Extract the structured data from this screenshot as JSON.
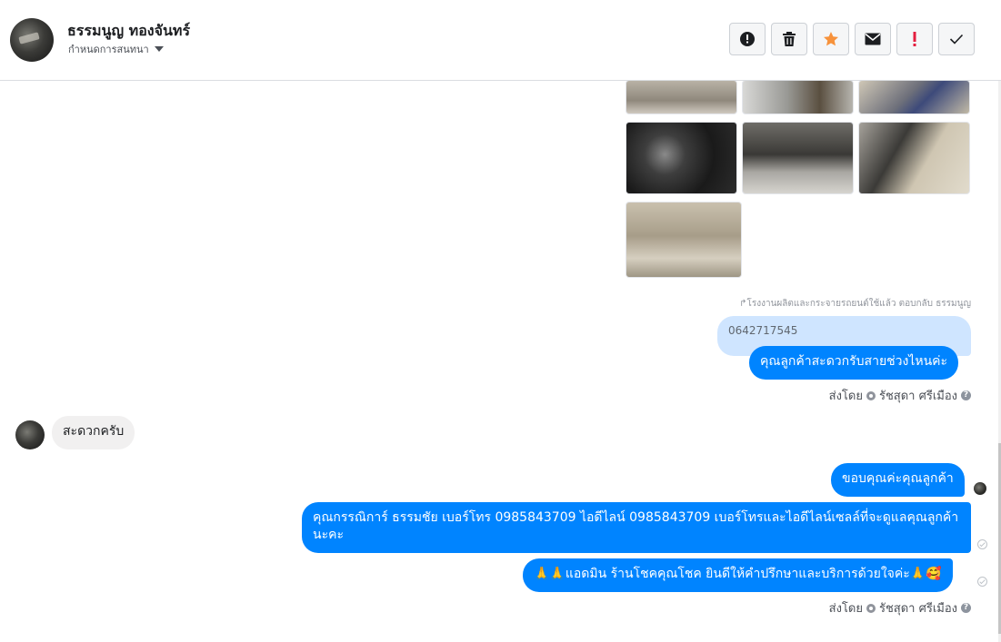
{
  "header": {
    "contact_name": "ธรรมนูญ ทองจันทร์",
    "conversation_setting": "กำหนดการสนทนา",
    "actions": [
      {
        "name": "mark-spam",
        "icon": "alert-circle-icon"
      },
      {
        "name": "delete",
        "icon": "trash-icon"
      },
      {
        "name": "star",
        "icon": "star-icon"
      },
      {
        "name": "mark-unread",
        "icon": "envelope-icon"
      },
      {
        "name": "priority",
        "icon": "exclamation-icon"
      },
      {
        "name": "done",
        "icon": "check-icon"
      }
    ]
  },
  "colors": {
    "outgoing": "#0084ff",
    "incoming": "#f1f0f0",
    "quoted": "#cfe5ff",
    "star": "#f7923b",
    "priority": "#e41e3f"
  },
  "thread": {
    "reply_note": "โรงงานผลิตและกระจายรถยนต์ใช้แล้ว ตอบกลับ ธรรมนูญ",
    "quoted_text": "0642717545",
    "msg_out_1": "คุณลูกค้าสะดวกรับสายช่วงไหนค่ะ",
    "sent_by_label": "ส่งโดย",
    "sent_by_name": "รัชสุดา ศรีเมือง",
    "msg_in_1": "สะดวกครับ",
    "msg_out_2": "ขอบคุณค่ะคุณลูกค้า",
    "msg_out_3": "คุณกรรณิการ์ ธรรมชัย     เบอร์โทร 0985843709  ไอดีไลน์ 0985843709   เบอร์โทรและไอดีไลน์เซลล์ที่จะดูแลคุณลูกค้านะคะ",
    "msg_out_4": "🙏🙏แอดมิน ร้านโชคคุณโชค ยินดีให้คำปรึกษาและบริการด้วยใจค่ะ🙏🥰",
    "sent_by_label_2": "ส่งโดย",
    "sent_by_name_2": "รัชสุดา ศรีเมือง"
  }
}
